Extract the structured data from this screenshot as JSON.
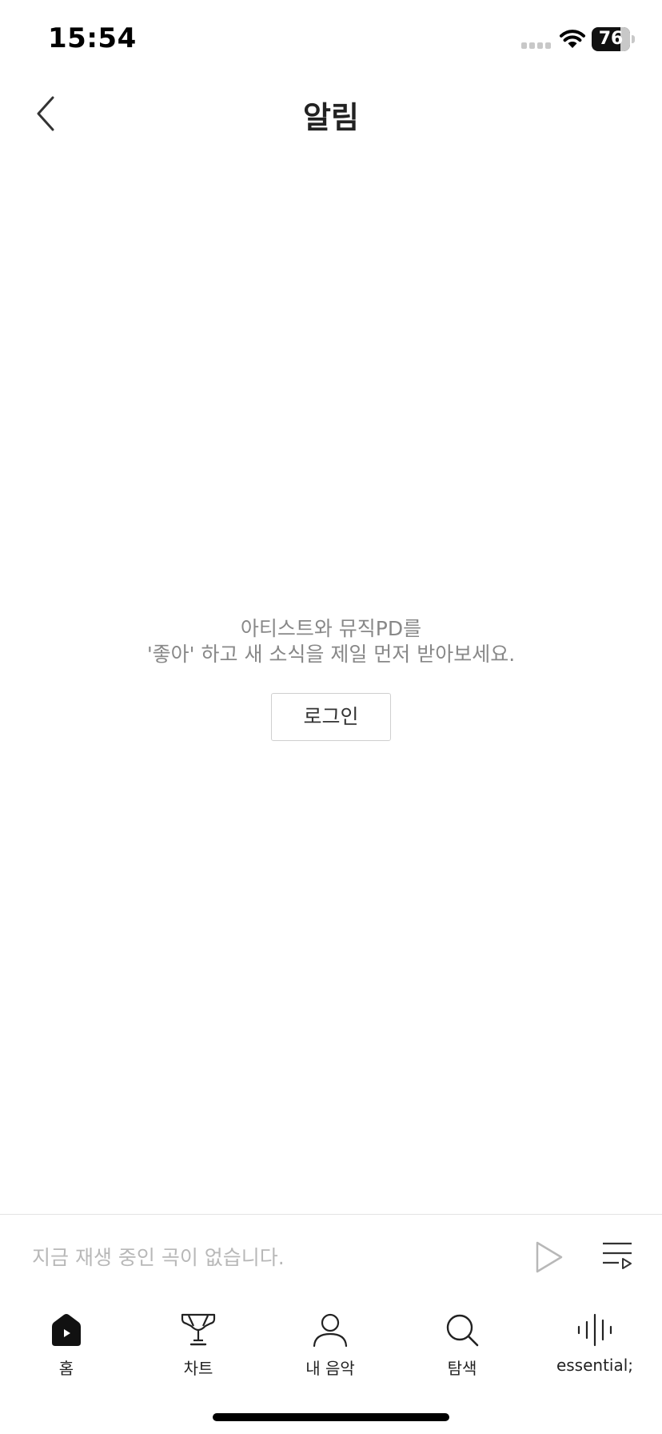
{
  "status_bar": {
    "time": "15:54",
    "battery_level": "76",
    "battery_percent": 76
  },
  "header": {
    "title": "알림"
  },
  "empty_state": {
    "line1": "아티스트와 뮤직PD를",
    "line2": "'좋아' 하고 새 소식을 제일 먼저 받아보세요.",
    "login_label": "로그인"
  },
  "mini_player": {
    "status": "지금 재생 중인 곡이 없습니다."
  },
  "tabs": [
    {
      "label": "홈",
      "icon": "home-icon",
      "active": true
    },
    {
      "label": "차트",
      "icon": "trophy-icon",
      "active": false
    },
    {
      "label": "내 음악",
      "icon": "person-icon",
      "active": false
    },
    {
      "label": "탐색",
      "icon": "search-icon",
      "active": false
    },
    {
      "label": "essential;",
      "icon": "soundwave-icon",
      "active": false
    }
  ],
  "colors": {
    "text_primary": "#222222",
    "text_muted": "#888888",
    "text_placeholder": "#b8b8b8",
    "divider": "#e3e3e3"
  }
}
